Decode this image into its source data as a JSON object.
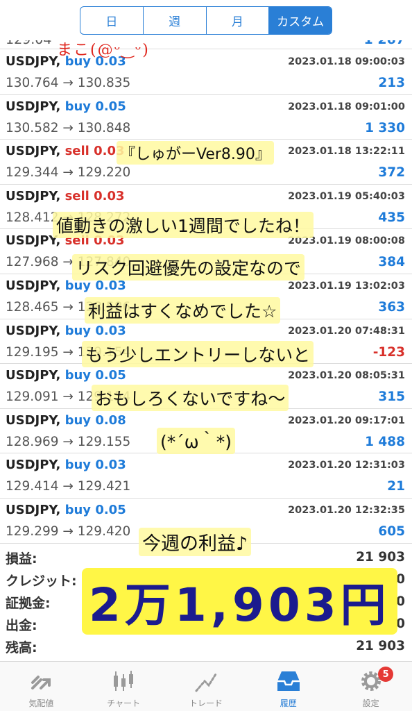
{
  "segmented": {
    "tabs": [
      "日",
      "週",
      "月",
      "カスタム"
    ],
    "active_index": 3
  },
  "partial_row": {
    "left": "129.04",
    "right": "1 267"
  },
  "trades": [
    {
      "symbol": "USDJPY,",
      "side": "buy",
      "volume": "0.03",
      "time": "2023.01.18 09:00:03",
      "prices": "130.764 → 130.835",
      "profit": "213"
    },
    {
      "symbol": "USDJPY,",
      "side": "buy",
      "volume": "0.05",
      "time": "2023.01.18 09:01:00",
      "prices": "130.582 → 130.848",
      "profit": "1 330"
    },
    {
      "symbol": "USDJPY,",
      "side": "sell",
      "volume": "0.03",
      "time": "2023.01.18 13:22:11",
      "prices": "129.344 → 129.220",
      "profit": "372"
    },
    {
      "symbol": "USDJPY,",
      "side": "sell",
      "volume": "0.03",
      "time": "2023.01.19 05:40:03",
      "prices": "128.412 → 128.272",
      "profit": "435"
    },
    {
      "symbol": "USDJPY,",
      "side": "sell",
      "volume": "0.03",
      "time": "2023.01.19 08:00:08",
      "prices": "127.968 → 127.840",
      "profit": "384"
    },
    {
      "symbol": "USDJPY,",
      "side": "buy",
      "volume": "0.03",
      "time": "2023.01.19 13:02:03",
      "prices": "128.465 → 128.586",
      "profit": "363"
    },
    {
      "symbol": "USDJPY,",
      "side": "buy",
      "volume": "0.03",
      "time": "2023.01.20 07:48:31",
      "prices": "129.195 → 129.154",
      "profit": "-123"
    },
    {
      "symbol": "USDJPY,",
      "side": "buy",
      "volume": "0.05",
      "time": "2023.01.20 08:05:31",
      "prices": "129.091 → 129.154",
      "profit": "315"
    },
    {
      "symbol": "USDJPY,",
      "side": "buy",
      "volume": "0.08",
      "time": "2023.01.20 09:17:01",
      "prices": "128.969 → 129.155",
      "profit": "1 488"
    },
    {
      "symbol": "USDJPY,",
      "side": "buy",
      "volume": "0.03",
      "time": "2023.01.20 12:31:03",
      "prices": "129.414 → 129.421",
      "profit": "21"
    },
    {
      "symbol": "USDJPY,",
      "side": "buy",
      "volume": "0.05",
      "time": "2023.01.20 12:32:35",
      "prices": "129.299 → 129.420",
      "profit": "605"
    }
  ],
  "summary": [
    {
      "label": "損益:",
      "value": "21 903"
    },
    {
      "label": "クレジット:",
      "value": "0"
    },
    {
      "label": "証拠金:",
      "value": "0"
    },
    {
      "label": "出金:",
      "value": "0"
    },
    {
      "label": "残高:",
      "value": "21 903"
    }
  ],
  "tabbar": {
    "items": [
      {
        "label": "気配値",
        "icon": "quotes-icon"
      },
      {
        "label": "チャート",
        "icon": "chart-icon"
      },
      {
        "label": "トレード",
        "icon": "trade-icon"
      },
      {
        "label": "履歴",
        "icon": "history-icon"
      },
      {
        "label": "設定",
        "icon": "settings-icon"
      }
    ],
    "active_index": 3,
    "settings_badge": "5"
  },
  "overlays": {
    "red_note": "まこ(@ᵕ‿ᵕ)",
    "name_tag": "『しゅがーVer8.90』",
    "line1": "値動きの激しい1週間でしたね！",
    "line2": "リスク回避優先の設定なので",
    "line3": "利益はすくなめでした☆",
    "line4": "もう少しエントリーしないと",
    "line5": "おもしろくないですね〜",
    "face": "(*´ω｀*)",
    "weekly": "今週の利益♪",
    "big_total": "2万1,903円"
  },
  "colors": {
    "accent": "#2a7fd6",
    "buy": "#1e7bd9",
    "sell": "#d8302a",
    "badge": "#e53935",
    "highlight": "#fff53c"
  }
}
